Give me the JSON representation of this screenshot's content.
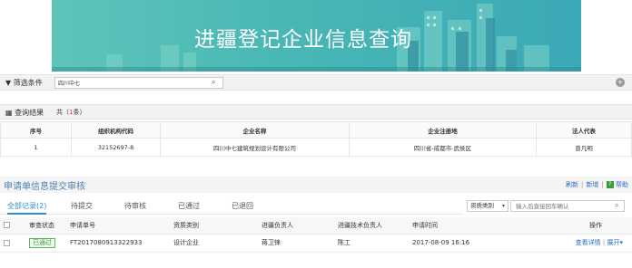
{
  "banner": {
    "title": "进疆登记企业信息查询"
  },
  "filter": {
    "label": "筛选条件",
    "value": "四川中七"
  },
  "results": {
    "title": "查询结果",
    "count_prefix": "共（",
    "count": "1",
    "count_suffix": "条）",
    "columns": [
      "序号",
      "组织机构代码",
      "企业名称",
      "企业注册地",
      "法人代表"
    ],
    "rows": [
      [
        "1",
        "32152697-8",
        "四川中七建筑规划设计有限公司",
        "四川省-成都市-武侯区",
        "曾凡明"
      ]
    ]
  },
  "review": {
    "title": "申请单信息提交审核",
    "refresh": "刷新",
    "add": "新增",
    "help": "帮助",
    "tabs": [
      "全部记录(2)",
      "待提交",
      "待审核",
      "已通过",
      "已退回"
    ],
    "type_select": "资质类别",
    "search_placeholder": "输入后直接回车确认",
    "columns": [
      "",
      "审查状态",
      "申请单号",
      "资质类别",
      "进疆负责人",
      "进疆技术负责人",
      "申请时间",
      "操作"
    ],
    "rows": [
      {
        "status": "已通过",
        "no": "FT2017080913322933",
        "type": "设计企业",
        "lead": "蒋卫锋",
        "tech": "陈工",
        "time": "2017-08-09 16:16",
        "view": "查看详情",
        "expand": "展开"
      }
    ]
  },
  "colors": {
    "accent": "#2b8fd6",
    "banner": "#48b7b5",
    "success": "#3a9c3a"
  }
}
